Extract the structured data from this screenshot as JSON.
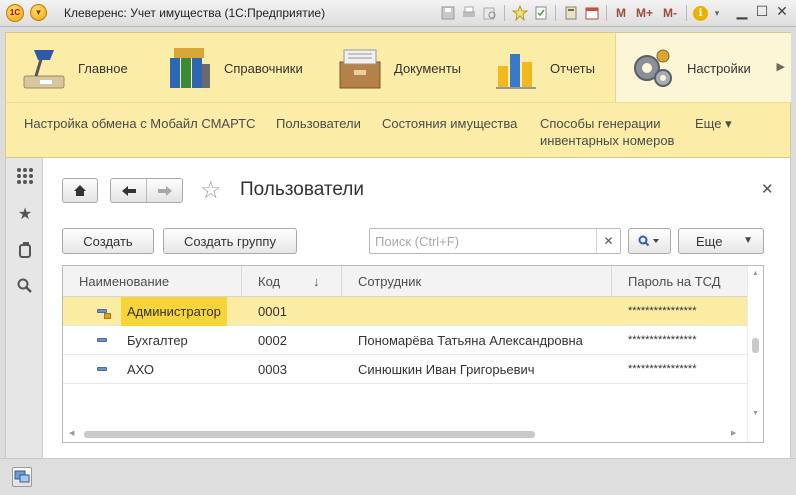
{
  "window": {
    "title": "Клеверенс: Учет имущества  (1С:Предприятие)",
    "toolbar_m": "M",
    "toolbar_m_plus": "M+",
    "toolbar_m_minus": "M-",
    "toolbar_info": "i"
  },
  "sections": [
    {
      "label": "Главное",
      "icon": "desk-lamp-icon"
    },
    {
      "label": "Справочники",
      "icon": "binders-icon"
    },
    {
      "label": "Документы",
      "icon": "documents-box-icon"
    },
    {
      "label": "Отчеты",
      "icon": "bar-chart-icon"
    },
    {
      "label": "Настройки",
      "icon": "gears-icon"
    }
  ],
  "subpanel": {
    "items": [
      {
        "label": "Настройка обмена с Мобайл СМАРТС"
      },
      {
        "label": "Пользователи"
      },
      {
        "label": "Состояния имущества"
      },
      {
        "label": "Способы генерации\nинвентарных номеров"
      },
      {
        "label": "Еще ▾"
      }
    ]
  },
  "form": {
    "title": "Пользователи",
    "create_button": "Создать",
    "create_group_button": "Создать группу",
    "search_placeholder": "Поиск (Ctrl+F)",
    "more_button": "Еще"
  },
  "table": {
    "columns": [
      "Наименование",
      "Код",
      "Сотрудник",
      "Пароль на ТСД"
    ],
    "rows": [
      {
        "name": "Администратор",
        "code": "0001",
        "employee": "",
        "password": "****************",
        "selected": true,
        "group": true
      },
      {
        "name": "Бухгалтер",
        "code": "0002",
        "employee": "Пономарёва Татьяна Александровна",
        "password": "****************",
        "selected": false,
        "group": false
      },
      {
        "name": "АХО",
        "code": "0003",
        "employee": "Синюшкин Иван Григорьевич",
        "password": "****************",
        "selected": false,
        "group": false
      }
    ]
  },
  "colors": {
    "panel_yellow": "#fbeca8",
    "selected_row": "#fbeca4",
    "selected_cell": "#f7d539"
  }
}
